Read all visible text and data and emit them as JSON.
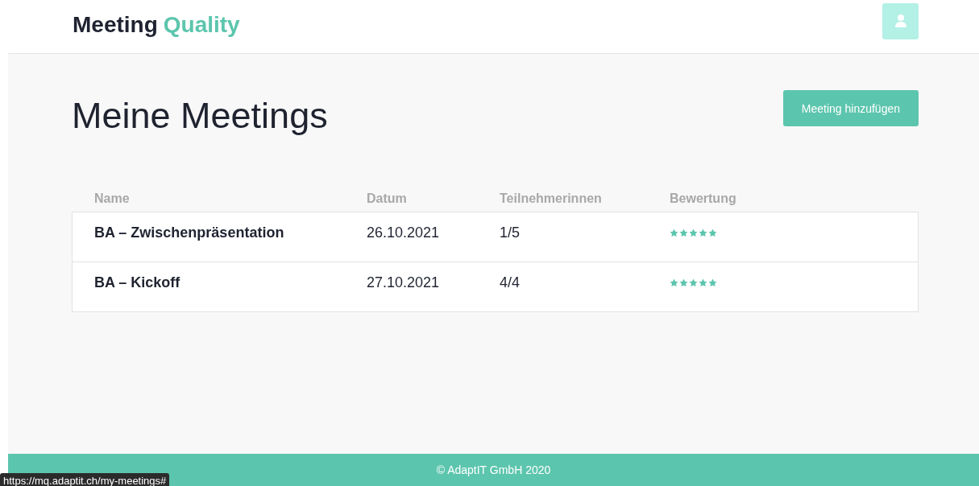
{
  "header": {
    "logo": {
      "first": "Meeting",
      "second": "Quality"
    }
  },
  "page": {
    "title": "Meine Meetings",
    "add_button": "Meeting hinzufügen"
  },
  "table": {
    "columns": [
      "Name",
      "Datum",
      "Teilnehmerinnen",
      "Bewertung"
    ],
    "rows": [
      {
        "name": "BA – Zwischenpräsentation",
        "date": "26.10.2021",
        "participants": "1/5",
        "stars": 5
      },
      {
        "name": "BA – Kickoff",
        "date": "27.10.2021",
        "participants": "4/4",
        "stars": 5
      }
    ]
  },
  "footer": "© AdaptIT GmbH 2020",
  "status_url": "https://mq.adaptit.ch/my-meetings#"
}
